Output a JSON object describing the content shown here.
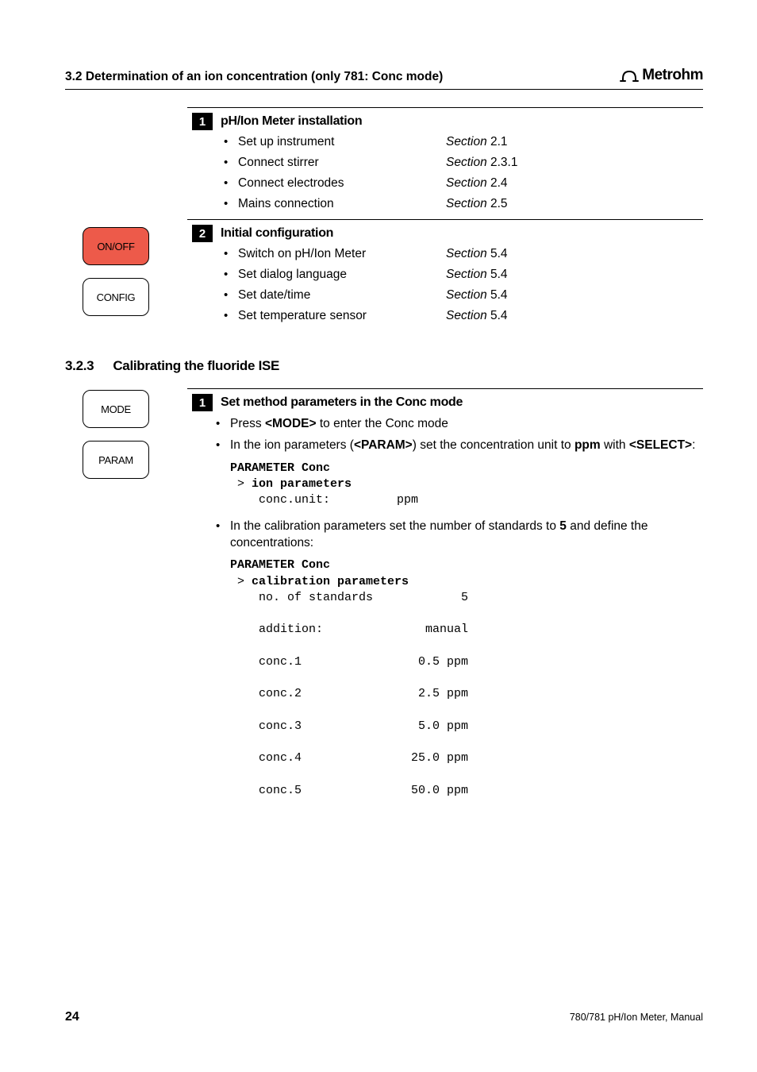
{
  "header": {
    "section_title": "3.2 Determination of an ion concentration (only 781: Conc mode)",
    "brand": "Metrohm"
  },
  "block1": {
    "num": "1",
    "title": "pH/Ion Meter installation",
    "items": [
      {
        "text": "Set up instrument",
        "ref_italic": "Section",
        "ref_plain": " 2.1"
      },
      {
        "text": "Connect stirrer",
        "ref_italic": "Section",
        "ref_plain": " 2.3.1"
      },
      {
        "text": "Connect electrodes",
        "ref_italic": "Section",
        "ref_plain": " 2.4"
      },
      {
        "text": "Mains connection",
        "ref_italic": "Section",
        "ref_plain": " 2.5"
      }
    ]
  },
  "block2": {
    "num": "2",
    "title": "Initial configuration",
    "keys": [
      "ON/OFF",
      "CONFIG"
    ],
    "items": [
      {
        "text": "Switch on pH/Ion Meter",
        "ref_italic": "Section",
        "ref_plain": " 5.4"
      },
      {
        "text": "Set dialog language",
        "ref_italic": "Section",
        "ref_plain": " 5.4"
      },
      {
        "text": "Set date/time",
        "ref_italic": "Section",
        "ref_plain": " 5.4"
      },
      {
        "text": "Set temperature sensor",
        "ref_italic": "Section",
        "ref_plain": " 5.4"
      }
    ]
  },
  "subsection": {
    "num": "3.2.3",
    "title": "Calibrating the fluoride ISE"
  },
  "block3": {
    "num": "1",
    "title": "Set method parameters in the Conc mode",
    "keys": [
      "MODE",
      "PARAM"
    ],
    "line1_a": "Press ",
    "line1_b": "<MODE>",
    "line1_c": " to enter the Conc mode",
    "line2_a": "In the ion parameters (",
    "line2_b": "<PARAM>",
    "line2_c": ") set the concentration unit to ",
    "line2_d": "ppm",
    "line2_e": " with ",
    "line2_f": "<SELECT>",
    "line2_g": ":",
    "mono1_l1": "PARAMETER Conc",
    "mono1_l2": "ion parameters",
    "mono1_l3_label": "    conc.unit:",
    "mono1_l3_val": "ppm",
    "line3_a": "In the calibration parameters set the number of standards to ",
    "line3_b": "5",
    "line3_c": " and define the concentrations:",
    "mono2_l1": "PARAMETER Conc",
    "mono2_l2": "calibration parameters",
    "mono2_rows": [
      {
        "label": "    no. of standards",
        "val": "5"
      },
      {
        "label": "    addition:",
        "val": "manual"
      },
      {
        "label": "    conc.1",
        "val": "0.5 ppm"
      },
      {
        "label": "    conc.2",
        "val": "2.5 ppm"
      },
      {
        "label": "    conc.3",
        "val": "5.0 ppm"
      },
      {
        "label": "    conc.4",
        "val": "25.0 ppm"
      },
      {
        "label": "    conc.5",
        "val": "50.0 ppm"
      }
    ]
  },
  "footer": {
    "page": "24",
    "text": "780/781 pH/Ion Meter, Manual"
  }
}
